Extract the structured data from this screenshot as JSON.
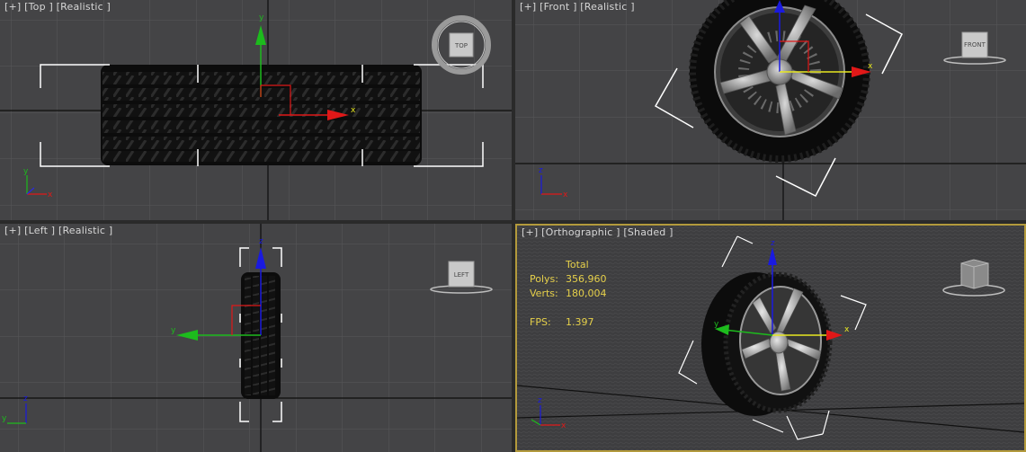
{
  "viewports": {
    "top": {
      "label": "[+] [Top ] [Realistic ]",
      "viewcube_label": "TOP"
    },
    "front": {
      "label": "[+] [Front ] [Realistic ]",
      "viewcube_label": "FRONT"
    },
    "left": {
      "label": "[+] [Left ] [Realistic ]",
      "viewcube_label": "LEFT"
    },
    "perspective": {
      "label": "[+] [Orthographic ] [Shaded ]"
    }
  },
  "stats": {
    "header": "Total",
    "polys_label": "Polys:",
    "polys_value": "356,960",
    "verts_label": "Verts:",
    "verts_value": "180,004",
    "fps_label": "FPS:",
    "fps_value": "1.397"
  },
  "axes": {
    "x": "x",
    "y": "y",
    "z": "z"
  },
  "colors": {
    "active_border": "#b39a3c",
    "stats_text": "#e6d04a",
    "axis_x": "#e01818",
    "axis_y": "#1dbb1d",
    "axis_z": "#1a1ae0"
  }
}
